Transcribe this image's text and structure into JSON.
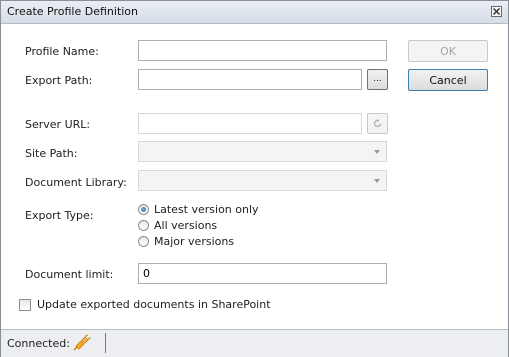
{
  "window": {
    "title": "Create Profile Definition",
    "close_icon": "close-icon"
  },
  "form": {
    "profile_name_label": "Profile Name:",
    "profile_name_value": "",
    "export_path_label": "Export Path:",
    "export_path_value": "",
    "browse_button_label": "...",
    "server_url_label": "Server URL:",
    "server_url_value": "",
    "refresh_icon": "refresh-icon",
    "site_path_label": "Site Path:",
    "site_path_value": "",
    "document_library_label": "Document Library:",
    "document_library_value": "",
    "export_type_label": "Export Type:",
    "export_type_options": [
      {
        "label": "Latest version only",
        "selected": true
      },
      {
        "label": "All versions",
        "selected": false
      },
      {
        "label": "Major versions",
        "selected": false
      }
    ],
    "document_limit_label": "Document limit:",
    "document_limit_value": "0",
    "update_checkbox_label": "Update exported documents in SharePoint",
    "update_checkbox_checked": false
  },
  "buttons": {
    "ok_label": "OK",
    "ok_enabled": false,
    "cancel_label": "Cancel"
  },
  "status": {
    "connected_label": "Connected:",
    "connection_icon": "plug-icon"
  }
}
